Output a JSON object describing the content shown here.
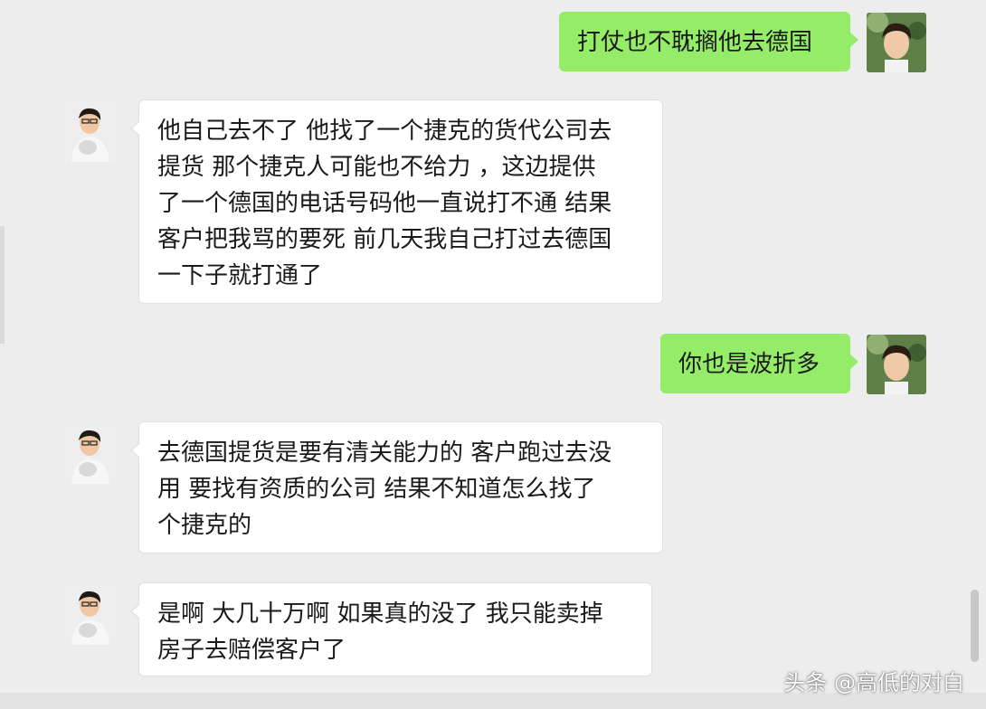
{
  "messages": [
    {
      "side": "me",
      "text": "打仗也不耽搁他去德国"
    },
    {
      "side": "other",
      "text": "他自己去不了 他找了一个捷克的货代公司去\n提货 那个捷克人可能也不给力 ，这边提供\n了一个德国的电话号码他一直说打不通 结果\n客户把我骂的要死 前几天我自己打过去德国\n一下子就打通了"
    },
    {
      "side": "me",
      "text": "你也是波折多"
    },
    {
      "side": "other",
      "text": "去德国提货是要有清关能力的 客户跑过去没\n用 要找有资质的公司 结果不知道怎么找了\n个捷克的"
    },
    {
      "side": "other",
      "text": "是啊 大几十万啊 如果真的没了 我只能卖掉\n房子去赔偿客户了"
    }
  ],
  "watermark": "头条 @高低的对白",
  "colors": {
    "background": "#ededed",
    "my_bubble": "#95ec69",
    "other_bubble": "#ffffff"
  }
}
